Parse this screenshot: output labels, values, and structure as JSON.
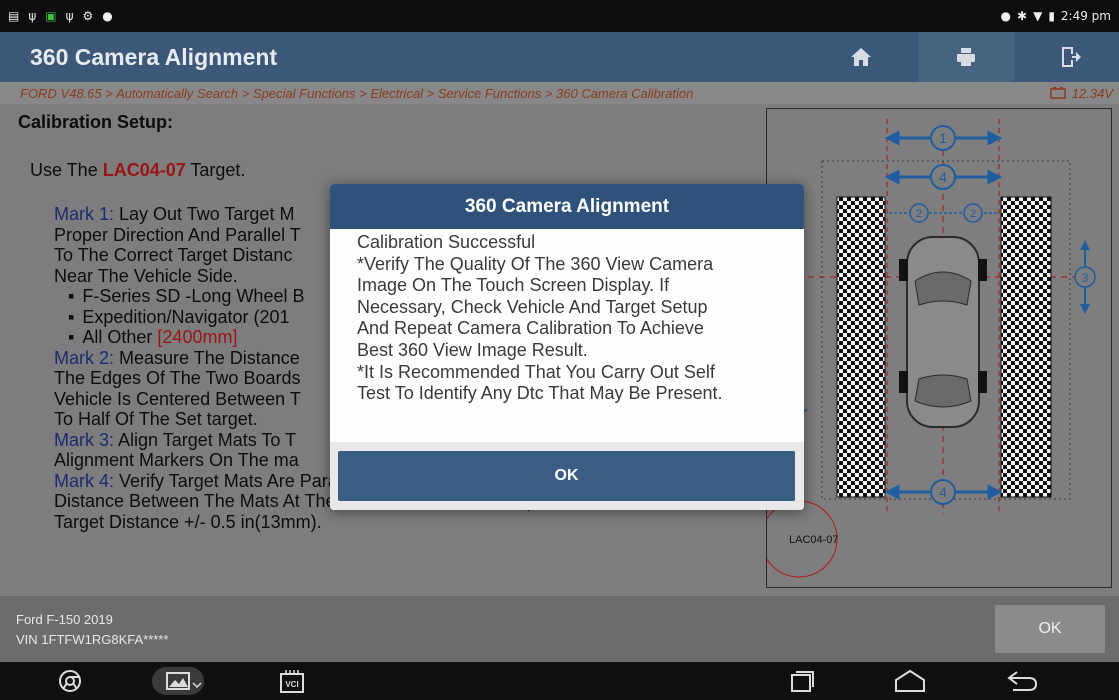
{
  "status_bar": {
    "time": "2:49 pm"
  },
  "header": {
    "title": "360 Camera Alignment",
    "buttons": [
      "home-icon",
      "print-icon",
      "exit-icon"
    ]
  },
  "breadcrumb": {
    "path": "FORD V48.65 > Automatically Search > Special Functions > Electrical > Service Functions > 360 Camera Calibration",
    "voltage": "12.34V"
  },
  "content": {
    "heading": "Calibration Setup:",
    "target_prefix": "Use The ",
    "target_code": "LAC04-07",
    "target_suffix": " Target.",
    "mark1_label": "Mark 1:",
    "mark1_text": " Lay Out Two Target M",
    "mark1_l2": "Proper Direction And Parallel T",
    "mark1_l3": "To The Correct Target Distanc",
    "mark1_l4": "Near The Vehicle Side.",
    "bullets": [
      {
        "label": "F-Series SD -Long Wheel B",
        "value": ""
      },
      {
        "label": "Expedition/Navigator (201",
        "value": ""
      },
      {
        "label": "All Other ",
        "value": "[2400mm]"
      }
    ],
    "mark2_label": "Mark 2:",
    "mark2_text": " Measure The Distance",
    "mark2_l2": "The Edges Of The Two Boards",
    "mark2_l3": "Vehicle Is Centered Between T",
    "mark2_l4": "To Half Of The Set target.",
    "mark3_label": "Mark 3:",
    "mark3_text": " Align Target Mats To T",
    "mark3_l2": "Alignment Markers On The ma",
    "mark4_label": "Mark 4:",
    "mark4_text": " Verify Target Mats Are Parallel To Each Other By Measuring The",
    "mark4_l2": "Distance Between The Mats At The Front And rear. Must Equal The Set",
    "mark4_l3": "Target Distance +/- 0.5 in(13mm)."
  },
  "diagram": {
    "labels": [
      "1",
      "4",
      "2",
      "2",
      "3",
      "4"
    ],
    "target_label": "LAC04-07"
  },
  "footer": {
    "vehicle_model": "Ford F-150 2019",
    "vin": "VIN 1FTFW1RG8KFA*****",
    "ok_label": "OK"
  },
  "dialog": {
    "title": "360 Camera Alignment",
    "lines": [
      "Calibration Successful",
      "*Verify The Quality Of The 360 View Camera",
      "Image On The Touch Screen Display. If",
      "Necessary, Check Vehicle And Target Setup",
      "And Repeat Camera Calibration To Achieve",
      "Best 360 View Image Result.",
      "*It Is Recommended That You Carry Out Self",
      "Test To Identify Any Dtc That May Be Present."
    ],
    "ok_label": "OK"
  },
  "navbar": {
    "vci_label": "VCI",
    "items": [
      "chrome-icon",
      "gallery-icon",
      "vci-icon",
      "recents-icon",
      "home-nav-icon",
      "back-icon"
    ]
  },
  "colors": {
    "header_bg": "#3b5878",
    "dialog_title_bg": "#2e5279",
    "dialog_button_bg": "#3b5d84",
    "mark_color": "#1a2a72",
    "highlight_red": "#9b1414"
  }
}
